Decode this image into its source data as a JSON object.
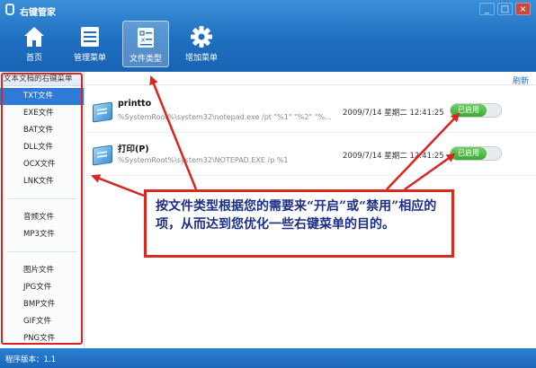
{
  "window": {
    "title": "右键管家",
    "controls": [
      "_",
      "□",
      "×"
    ]
  },
  "toolbar": {
    "items": [
      {
        "label": "首页",
        "icon": "home-icon"
      },
      {
        "label": "管理菜单",
        "icon": "menu-list-icon"
      },
      {
        "label": "文件类型",
        "icon": "file-type-icon",
        "active": true
      },
      {
        "label": "增加菜单",
        "icon": "gear-icon"
      }
    ]
  },
  "sidebar": {
    "header": "文本文档的右键菜单",
    "groups": [
      [
        "TXT文件",
        "EXE文件",
        "BAT文件",
        "DLL文件",
        "OCX文件",
        "LNK文件"
      ],
      [
        "音频文件",
        "MP3文件"
      ],
      [
        "图片文件",
        "JPG文件",
        "BMP文件",
        "GIF文件",
        "PNG文件"
      ]
    ],
    "selected": "TXT文件"
  },
  "main": {
    "refresh_label": "刷新",
    "rows": [
      {
        "name": "printto",
        "command": "%SystemRoot%\\system32\\notepad.exe /pt \"%1\" \"%2\" \"%...",
        "date": "2009/7/14 星期二 12:41:25",
        "status": "已启用"
      },
      {
        "name": "打印(P)",
        "command": "%SystemRoot%\\system32\\NOTEPAD.EXE /p %1",
        "date": "2009/7/14 星期二 12:41:25",
        "status": "已启用"
      }
    ]
  },
  "callout": {
    "text": "按文件类型根据您的需要来“开启”或“禁用”相应的项，从而达到您优化一些右键菜单的目的。"
  },
  "statusbar": {
    "version": "程序版本：1.1"
  },
  "colors": {
    "toolbar_blue": "#1f6fc0",
    "selected_blue": "#2f7ad6",
    "toggle_green": "#3ea832",
    "annotation_red": "#d72621",
    "callout_text": "#1b2f86"
  }
}
